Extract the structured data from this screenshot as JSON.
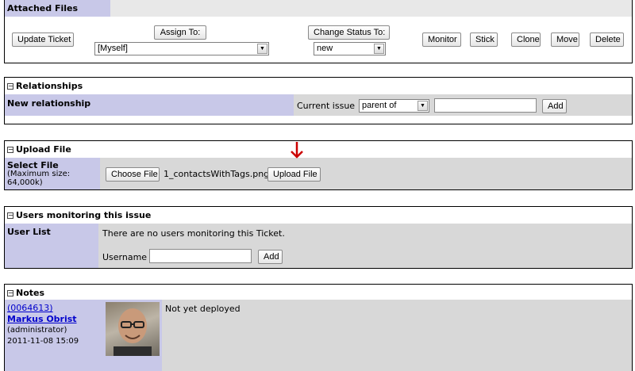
{
  "top": {
    "attached_files_label": "Attached Files",
    "update_ticket": "Update Ticket",
    "assign_to": "Assign To:",
    "assign_value": "[Myself]",
    "change_status": "Change Status To:",
    "status_value": "new",
    "monitor": "Monitor",
    "stick": "Stick",
    "clone": "Clone",
    "move": "Move",
    "delete": "Delete"
  },
  "relationships": {
    "title": "Relationships",
    "label": "New relationship",
    "current_issue": "Current issue",
    "relation_value": "parent of",
    "add": "Add"
  },
  "upload": {
    "title": "Upload File",
    "label": "Select File",
    "max_size": "(Maximum size: 64,000k)",
    "choose": "Choose File",
    "filename": "1_contactsWithTags.png",
    "upload_btn": "Upload File"
  },
  "monitoring": {
    "title": "Users monitoring this issue",
    "label": "User List",
    "message": "There are no users monitoring this Ticket.",
    "username_label": "Username",
    "add": "Add"
  },
  "notes": {
    "title": "Notes",
    "note_id": "(0064613)",
    "author": "Markus Obrist",
    "role": "(administrator)",
    "date": "2011-11-08 15:09",
    "text": "Not yet deployed"
  },
  "colors": {
    "category_bg": "#c8c8e8",
    "row_bg": "#d8d8d8",
    "arrow": "#cc0000"
  }
}
